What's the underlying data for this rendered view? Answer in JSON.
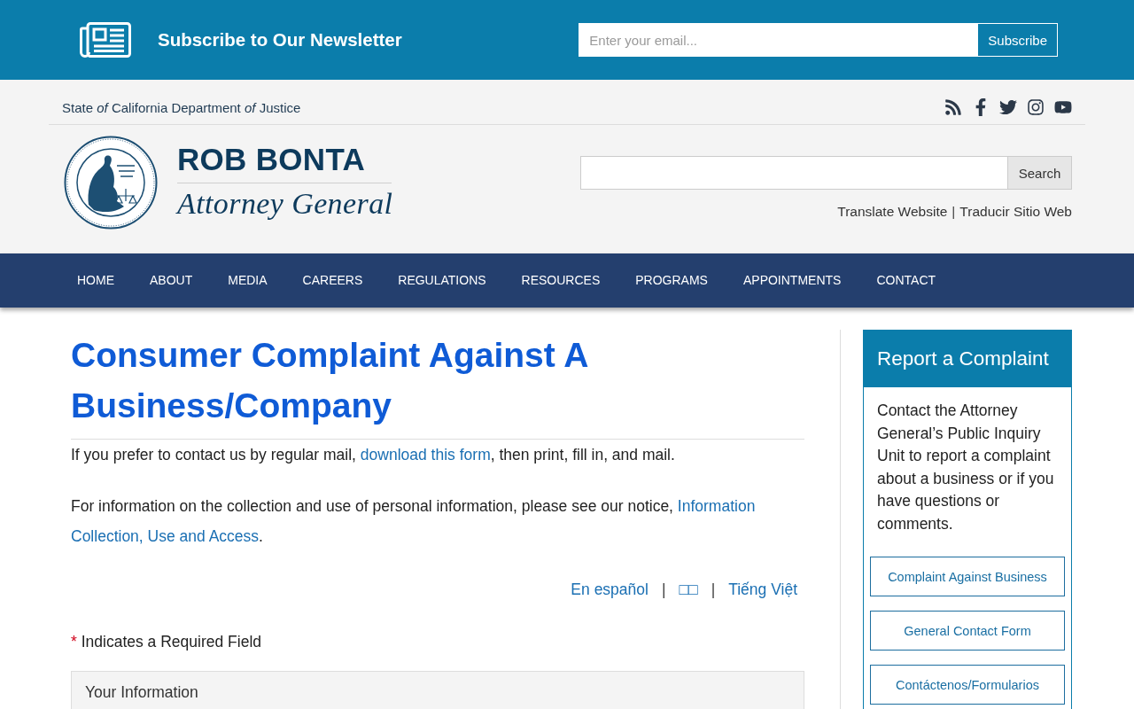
{
  "newsletter_bar": {
    "title": "Subscribe to Our Newsletter",
    "email_field": {
      "placeholder": "Enter your email..."
    },
    "subscribe_button": "Subscribe"
  },
  "header": {
    "agency": "State *of* California Department *of* Justice",
    "social_links": [
      {
        "kind": "rss"
      },
      {
        "kind": "facebook"
      },
      {
        "kind": "twitter"
      },
      {
        "kind": "instagram"
      },
      {
        "kind": "youtube"
      }
    ],
    "official_name": "ROB BONTA",
    "official_title": "Attorney General",
    "search": {
      "button": "Search"
    },
    "translate_links": [
      {
        "kind": "link",
        "label": "Translate Website"
      },
      {
        "kind": "separator",
        "label": "|"
      },
      {
        "kind": "link",
        "label": "Traducir Sitio Web"
      }
    ]
  },
  "nav": [
    {
      "label": "HOME"
    },
    {
      "label": "ABOUT"
    },
    {
      "label": "MEDIA"
    },
    {
      "label": "CAREERS"
    },
    {
      "label": "REGULATIONS"
    },
    {
      "label": "RESOURCES"
    },
    {
      "label": "PROGRAMS"
    },
    {
      "label": "APPOINTMENTS"
    },
    {
      "label": "CONTACT"
    }
  ],
  "main": {
    "heading": "Consumer Complaint Against A Business/Company",
    "paragraphs": [
      [
        {
          "kind": "text",
          "text": "If you prefer to contact us by regular mail, "
        },
        {
          "kind": "link",
          "text": "download this form"
        },
        {
          "kind": "text",
          "text": ", then print, fill in, and mail."
        }
      ],
      [
        {
          "kind": "text",
          "text": "For information on the collection and use of personal information, please see our notice, "
        },
        {
          "kind": "link",
          "text": "Information"
        },
        {
          "kind": "link",
          "text": "Collection, Use and Access"
        },
        {
          "kind": "text",
          "text": "."
        }
      ]
    ],
    "language_links": [
      {
        "kind": "link",
        "label": "En español"
      },
      {
        "kind": "separator",
        "label": "|"
      },
      {
        "kind": "link",
        "label": "□□"
      },
      {
        "kind": "separator",
        "label": "|"
      },
      {
        "kind": "link",
        "label": "Tiếng Việt"
      }
    ],
    "required_note": {
      "marker": "*",
      "text": "Indicates a Required Field"
    },
    "form_section": {
      "title": "Your Information"
    }
  },
  "sidebar": {
    "title": "Report a Complaint",
    "text": "Contact the Attorney General’s Public Inquiry Unit to report a complaint about a business or if you have questions or comments.",
    "buttons": [
      "Complaint Against Business",
      "General Contact Form",
      "Contáctenos/Formularios"
    ]
  }
}
